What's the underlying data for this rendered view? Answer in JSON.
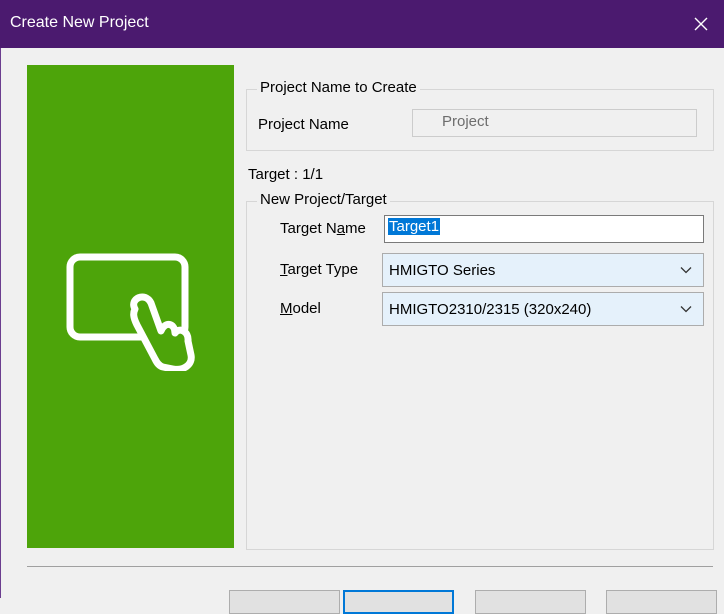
{
  "window": {
    "title": "Create New Project",
    "close_icon": "close-icon"
  },
  "banner": {
    "color": "#4da40a",
    "icon": "touch-screen-icon"
  },
  "project_group": {
    "legend": "Project Name to Create",
    "name_label": "Project Name",
    "name_value": "Project"
  },
  "target_counter": "Target : 1/1",
  "target_group": {
    "legend": "New Project/Target",
    "target_name_label_pre": "Target N",
    "target_name_label_u": "a",
    "target_name_label_post": "me",
    "target_name_value": "Target1",
    "target_type_label_u": "T",
    "target_type_label_post": "arget Type",
    "target_type_value": "HMIGTO Series",
    "model_label_u": "M",
    "model_label_post": "odel",
    "model_value": "HMIGTO2310/2315 (320x240)"
  },
  "colors": {
    "titlebar": "#4b1a6f",
    "selection": "#0078d7",
    "combo_bg": "#e5f1fb"
  }
}
